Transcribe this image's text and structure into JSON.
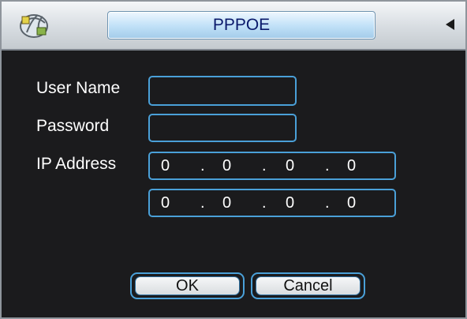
{
  "window": {
    "title": "PPPOE",
    "icon": "network-globe-icon"
  },
  "form": {
    "user_name_label": "User Name",
    "user_name_value": "",
    "password_label": "Password",
    "password_value": "",
    "ip_address_label": "IP Address",
    "ip_address": [
      "0",
      "0",
      "0",
      "0"
    ],
    "ip_address_2": [
      "0",
      "0",
      "0",
      "0"
    ],
    "separator": "."
  },
  "buttons": {
    "ok": "OK",
    "cancel": "Cancel"
  },
  "colors": {
    "background": "#1b1b1d",
    "field_border": "#4aa0d8",
    "title_text": "#0a1a6b",
    "label_text": "#ffffff"
  }
}
